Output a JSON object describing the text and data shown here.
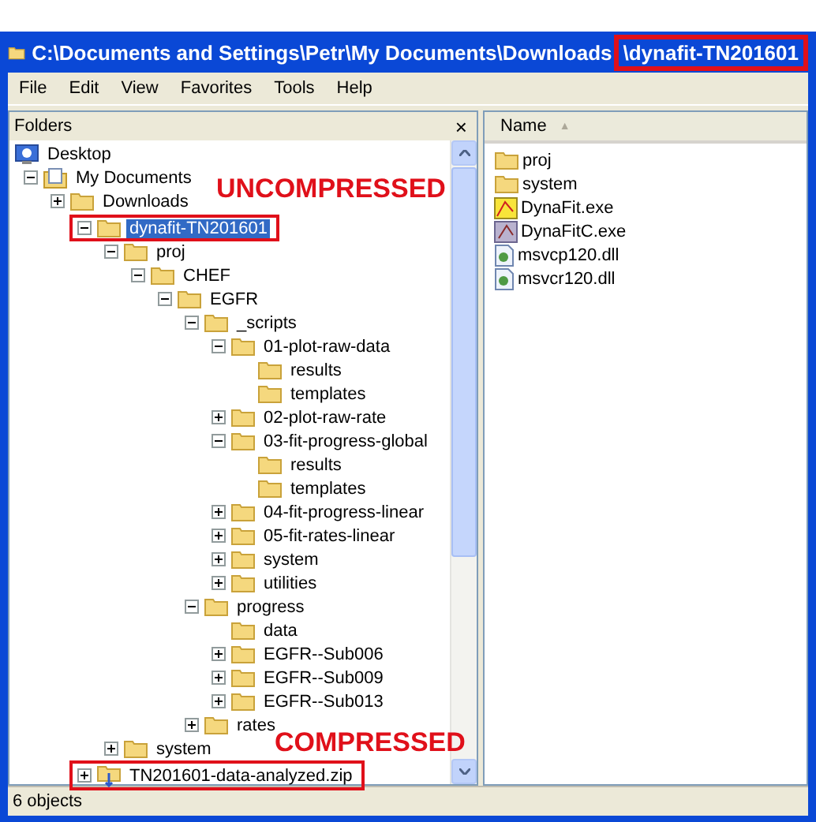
{
  "window": {
    "title": "C:\\Documents and Settings\\Petr\\My Documents\\Downloads",
    "title_highlight": "\\dynafit-TN201601"
  },
  "menu": [
    "File",
    "Edit",
    "View",
    "Favorites",
    "Tools",
    "Help"
  ],
  "folders_pane": {
    "title": "Folders",
    "close": "×",
    "tree": [
      {
        "label": "Desktop",
        "kind": "desktop",
        "selected": false,
        "highlighted": false,
        "children": [
          {
            "label": "My Documents",
            "kind": "documents",
            "expanded": true,
            "selected": false,
            "highlighted": false,
            "children": [
              {
                "label": "Downloads",
                "kind": "folder",
                "expanded": false,
                "selected": false,
                "highlighted": false,
                "children": [
                  {
                    "label": "dynafit-TN201601",
                    "kind": "folder",
                    "expanded": true,
                    "selected": true,
                    "highlighted": true,
                    "children": [
                      {
                        "label": "proj",
                        "kind": "folder",
                        "expanded": true,
                        "selected": false,
                        "highlighted": false,
                        "children": [
                          {
                            "label": "CHEF",
                            "kind": "folder",
                            "expanded": true,
                            "selected": false,
                            "highlighted": false,
                            "children": [
                              {
                                "label": "EGFR",
                                "kind": "folder",
                                "expanded": true,
                                "selected": false,
                                "highlighted": false,
                                "children": [
                                  {
                                    "label": "_scripts",
                                    "kind": "folder",
                                    "expanded": true,
                                    "selected": false,
                                    "highlighted": false,
                                    "children": [
                                      {
                                        "label": "01-plot-raw-data",
                                        "kind": "folder",
                                        "expanded": true,
                                        "selected": false,
                                        "highlighted": false,
                                        "children": [
                                          {
                                            "label": "results",
                                            "kind": "folder",
                                            "selected": false,
                                            "highlighted": false
                                          },
                                          {
                                            "label": "templates",
                                            "kind": "folder",
                                            "selected": false,
                                            "highlighted": false
                                          }
                                        ]
                                      },
                                      {
                                        "label": "02-plot-raw-rate",
                                        "kind": "folder",
                                        "expanded": false,
                                        "selected": false,
                                        "highlighted": false
                                      },
                                      {
                                        "label": "03-fit-progress-global",
                                        "kind": "folder",
                                        "expanded": true,
                                        "selected": false,
                                        "highlighted": false,
                                        "children": [
                                          {
                                            "label": "results",
                                            "kind": "folder",
                                            "selected": false,
                                            "highlighted": false
                                          },
                                          {
                                            "label": "templates",
                                            "kind": "folder",
                                            "selected": false,
                                            "highlighted": false
                                          }
                                        ]
                                      },
                                      {
                                        "label": "04-fit-progress-linear",
                                        "kind": "folder",
                                        "expanded": false,
                                        "selected": false,
                                        "highlighted": false
                                      },
                                      {
                                        "label": "05-fit-rates-linear",
                                        "kind": "folder",
                                        "expanded": false,
                                        "selected": false,
                                        "highlighted": false
                                      },
                                      {
                                        "label": "system",
                                        "kind": "folder",
                                        "expanded": false,
                                        "selected": false,
                                        "highlighted": false
                                      },
                                      {
                                        "label": "utilities",
                                        "kind": "folder",
                                        "expanded": false,
                                        "selected": false,
                                        "highlighted": false
                                      }
                                    ]
                                  },
                                  {
                                    "label": "progress",
                                    "kind": "folder",
                                    "expanded": true,
                                    "selected": false,
                                    "highlighted": false,
                                    "children": [
                                      {
                                        "label": "data",
                                        "kind": "folder",
                                        "selected": false,
                                        "highlighted": false
                                      },
                                      {
                                        "label": "EGFR--Sub006",
                                        "kind": "folder",
                                        "expanded": false,
                                        "selected": false,
                                        "highlighted": false
                                      },
                                      {
                                        "label": "EGFR--Sub009",
                                        "kind": "folder",
                                        "expanded": false,
                                        "selected": false,
                                        "highlighted": false
                                      },
                                      {
                                        "label": "EGFR--Sub013",
                                        "kind": "folder",
                                        "expanded": false,
                                        "selected": false,
                                        "highlighted": false
                                      }
                                    ]
                                  },
                                  {
                                    "label": "rates",
                                    "kind": "folder",
                                    "expanded": false,
                                    "selected": false,
                                    "highlighted": false
                                  }
                                ]
                              }
                            ]
                          }
                        ]
                      },
                      {
                        "label": "system",
                        "kind": "folder",
                        "expanded": false,
                        "selected": false,
                        "highlighted": false
                      }
                    ]
                  },
                  {
                    "label": "TN201601-data-analyzed.zip",
                    "kind": "zip",
                    "expanded": false,
                    "selected": false,
                    "highlighted": true
                  }
                ]
              }
            ]
          }
        ]
      }
    ]
  },
  "annotations": [
    {
      "text": "UNCOMPRESSED",
      "kind": "top"
    },
    {
      "text": "COMPRESSED",
      "kind": "bottom"
    }
  ],
  "files_pane": {
    "column": "Name",
    "sort_mark": "▲",
    "files": [
      {
        "name": "proj",
        "kind": "folder"
      },
      {
        "name": "system",
        "kind": "folder"
      },
      {
        "name": "DynaFit.exe",
        "kind": "chart"
      },
      {
        "name": "DynaFitC.exe",
        "kind": "app"
      },
      {
        "name": "msvcp120.dll",
        "kind": "dll"
      },
      {
        "name": "msvcr120.dll",
        "kind": "dll"
      }
    ]
  },
  "status_bar": "6 objects"
}
